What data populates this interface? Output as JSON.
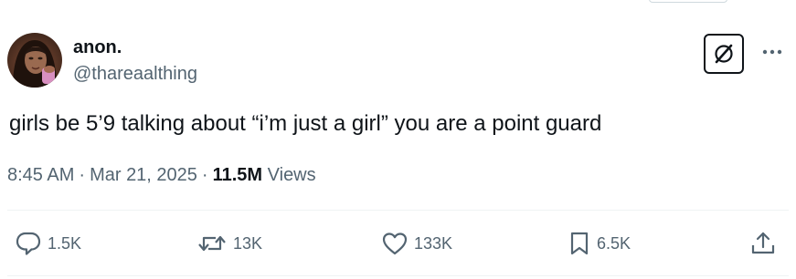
{
  "author": {
    "name": "anon.",
    "handle": "@thareaalthing"
  },
  "tweet": {
    "text": "girls be 5’9 talking about “i’m just a girl” you are a point guard"
  },
  "meta": {
    "time": "8:45 AM",
    "separator": "·",
    "date": "Mar 21, 2025",
    "views_count": "11.5M",
    "views_label": "Views"
  },
  "actions": {
    "replies": "1.5K",
    "reposts": "13K",
    "likes": "133K",
    "bookmarks": "6.5K"
  },
  "icons": {
    "grok": "grok-icon",
    "more": "more-horizontal-icon",
    "reply": "reply-icon",
    "repost": "repost-icon",
    "like": "heart-icon",
    "bookmark": "bookmark-icon",
    "share": "share-icon"
  },
  "colors": {
    "text_primary": "#0f1419",
    "text_secondary": "#536471",
    "divider": "#eff3f4"
  }
}
